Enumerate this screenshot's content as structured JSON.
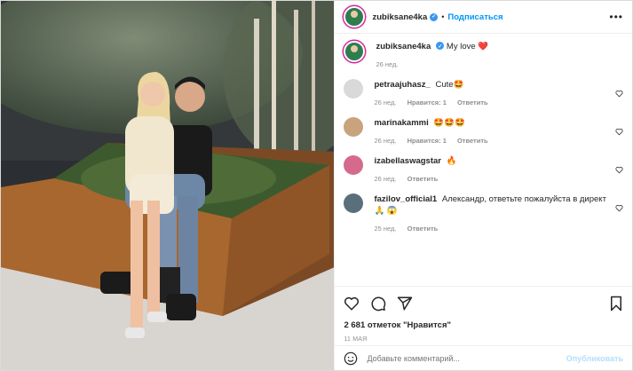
{
  "post": {
    "username": "zubiksane4ka",
    "follow_label": "Подписаться",
    "more_label": "•••",
    "caption": {
      "username": "zubiksane4ka",
      "text": "My love ❤️",
      "time": "26 нед."
    }
  },
  "comments": [
    {
      "username": "petraajuhasz_",
      "text": "Cute🤩",
      "time": "26 нед.",
      "likes": "Нравится: 1",
      "reply": "Ответить",
      "avatar_color": "#d9d9d9"
    },
    {
      "username": "marinakammi",
      "text": "🤩🤩🤩",
      "time": "26 нед.",
      "likes": "Нравится: 1",
      "reply": "Ответить",
      "avatar_color": "#c9a27e"
    },
    {
      "username": "izabellaswagstar",
      "text": "🔥",
      "time": "26 нед.",
      "likes": "",
      "reply": "Ответить",
      "avatar_color": "#d66a8c"
    },
    {
      "username": "fazilov_official1",
      "text": "Александр, ответьте пожалуйста в директ 🙏 😱",
      "time": "25 нед.",
      "likes": "",
      "reply": "Ответить",
      "avatar_color": "#5a6f7c"
    }
  ],
  "actions": {
    "likes_text": "2 681 отметок \"Нравится\"",
    "date": "11 МАЯ",
    "add_comment_placeholder": "Добавьте комментарий...",
    "publish_label": "Опубликовать"
  },
  "icons": [
    "heart-icon",
    "comment-icon",
    "share-icon",
    "bookmark-icon",
    "emoji-icon"
  ]
}
